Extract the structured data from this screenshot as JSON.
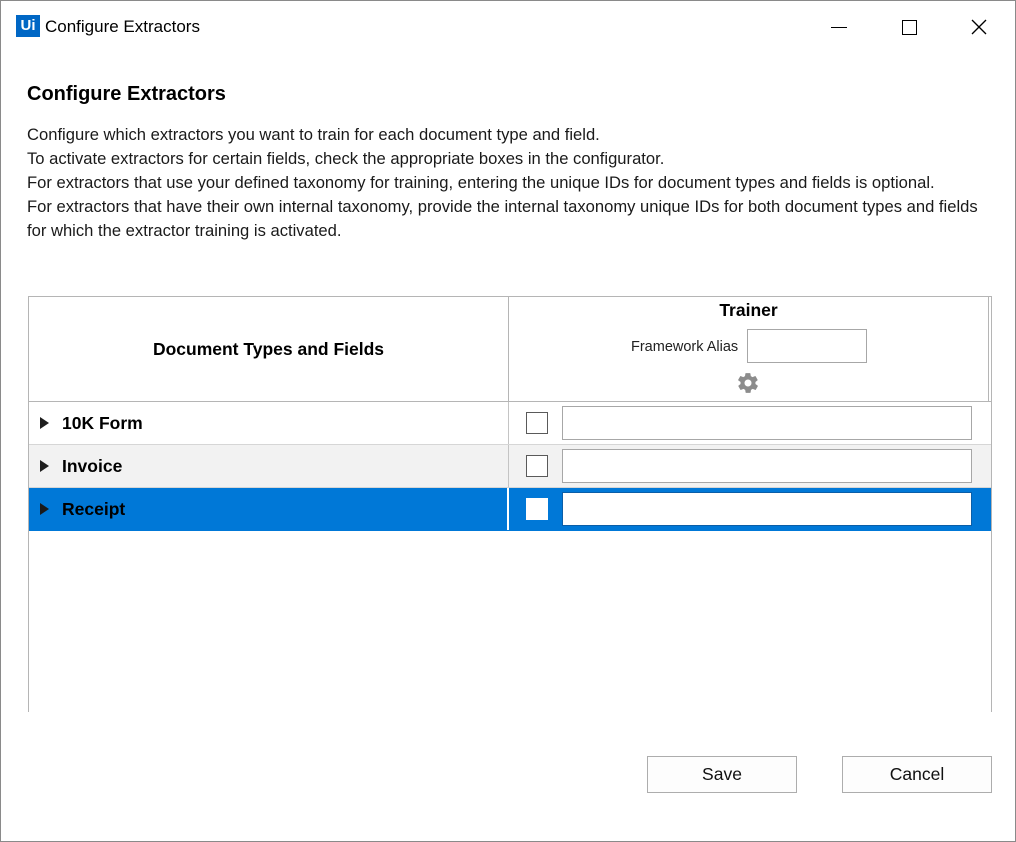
{
  "window": {
    "logo_text": "Ui",
    "title": "Configure Extractors",
    "controls": [
      "minimize-icon",
      "maximize-icon",
      "close-icon"
    ]
  },
  "dialog": {
    "heading": "Configure Extractors",
    "description": [
      "Configure which extractors you want to train for each document type and field.",
      "To activate extractors for certain fields, check the appropriate boxes in the configurator.",
      "For extractors that use your defined taxonomy for training, entering the unique IDs for document types and fields is optional.",
      "For extractors that have their own internal taxonomy, provide the internal taxonomy unique IDs for both document types and fields for which the extractor training is activated."
    ]
  },
  "grid": {
    "col1_header": "Document Types and Fields",
    "trainer_header": "Trainer",
    "framework_alias_label": "Framework Alias",
    "framework_alias_value": "",
    "settings_icon": "gear-icon",
    "rows": [
      {
        "label": "10K Form",
        "checked": false,
        "id_value": "",
        "selected": false
      },
      {
        "label": "Invoice",
        "checked": false,
        "id_value": "",
        "selected": false
      },
      {
        "label": "Receipt",
        "checked": false,
        "id_value": "",
        "selected": true
      }
    ]
  },
  "buttons": {
    "save": "Save",
    "cancel": "Cancel"
  },
  "colors": {
    "selection": "#0078d7",
    "logo": "#0067c5",
    "alt_row": "#f2f2f2"
  }
}
